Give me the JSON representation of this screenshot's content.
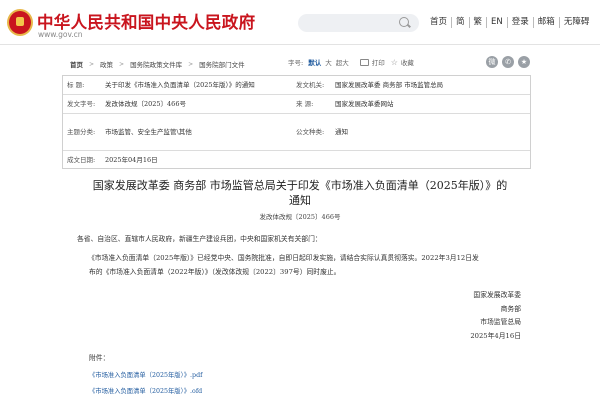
{
  "header": {
    "site_title": "中华人民共和国中央人民政府",
    "site_url": "www.gov.cn",
    "search_placeholder": "",
    "nav": [
      "首页",
      "简",
      "繁",
      "EN",
      "登录",
      "邮箱",
      "无障碍"
    ]
  },
  "breadcrumb": {
    "items": [
      "首页",
      "政策",
      "国务院政策文件库",
      "国务院部门文件"
    ]
  },
  "tools": {
    "font_size_label": "字号:",
    "font_sizes": [
      "默认",
      "大",
      "超大"
    ],
    "active_font_size": "默认",
    "print_label": "打印",
    "favorite_label": "收藏",
    "share_icons": [
      "weibo-icon",
      "wechat-icon",
      "qzone-icon"
    ]
  },
  "info_table": [
    {
      "k1": "标      题:",
      "v1": "关于印发《市场准入负面清单（2025年版）》的通知",
      "k2": "发文机关:",
      "v2": "国家发展改革委  商务部  市场监管总局"
    },
    {
      "k1": "发文字号:",
      "v1": "发改体改规〔2025〕466号",
      "k2": "来      源:",
      "v2": "国家发展改革委网站"
    },
    {
      "k1": "主题分类:",
      "v1": "市场监管、安全生产监管\\其他",
      "k2": "公文种类:",
      "v2": "通知"
    },
    {
      "k1": "成文日期:",
      "v1": "2025年04月16日",
      "k2": "",
      "v2": ""
    }
  ],
  "article": {
    "title_line1": "国家发展改革委  商务部  市场监管总局关于印发《市场准入负面清单（2025年版）》的",
    "title_line2": "通知",
    "doc_number": "发改体改规〔2025〕466号",
    "addressee": "各省、自治区、直辖市人民政府，新疆生产建设兵团，中央和国家机关有关部门：",
    "body_line1": "《市场准入负面清单（2025年版）》已经党中央、国务院批准，自即日起印发实施，请结合实际认真贯彻落实。2022年3月12日发",
    "body_line2": "布的《市场准入负面清单（2022年版）》（发改体改规〔2022〕397号）同时废止。",
    "signers": [
      "国家发展改革委",
      "商务部",
      "市场监管总局",
      "2025年4月16日"
    ],
    "attachments_label": "附件：",
    "attachments": [
      "《市场准入负面清单（2025年版）》.pdf",
      "《市场准入负面清单（2025年版）》.ofd"
    ]
  },
  "colors": {
    "brand_red": "#c9151e",
    "link_blue": "#1f5a9e"
  }
}
